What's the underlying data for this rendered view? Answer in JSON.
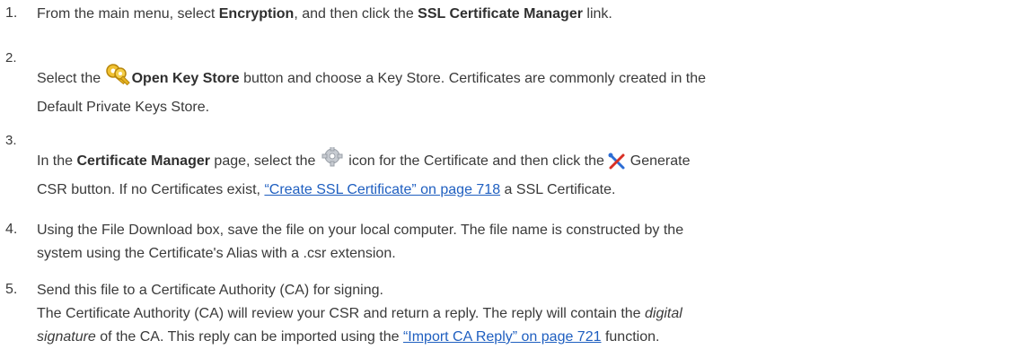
{
  "steps": [
    {
      "number": "1.",
      "pre": "From the main menu, select ",
      "b1": "Encryption",
      "mid": ", and then click the ",
      "b2": "SSL Certificate Manager",
      "post": " link."
    },
    {
      "number": "2.",
      "pre": "Select the ",
      "icon": "key-icon",
      "button": "Open Key Store",
      "post": " button and choose a Key Store. Certificates are commonly created in the",
      "line2": "Default Private Keys Store."
    },
    {
      "number": "3.",
      "pre": "In the ",
      "b1": "Certificate Manager",
      "mid": " page, select the ",
      "icon1": "gear-icon",
      "mid2": " icon for the Certificate and then click the ",
      "icon2": "tools-icon",
      "post": " Generate",
      "line2_pre": "CSR button. If no Certificates exist, ",
      "link": "“Create SSL Certificate” on page 718",
      "line2_post": " a SSL Certificate."
    },
    {
      "number": "4.",
      "line1": "Using the File Download box, save the file on your local computer. The file name is constructed by the",
      "line2": "system using the Certificate's Alias with a .csr extension."
    },
    {
      "number": "5.",
      "line1": "Send this file to a Certificate Authority (CA) for signing.",
      "line2_pre": "The Certificate Authority (CA) will review your CSR and return a reply. The reply will contain the ",
      "line2_i": "digital",
      "line3_i": "signature",
      "line3_mid": " of the CA. This reply can be imported using the ",
      "link": "“Import CA Reply” on page 721",
      "line3_post": " function."
    }
  ]
}
